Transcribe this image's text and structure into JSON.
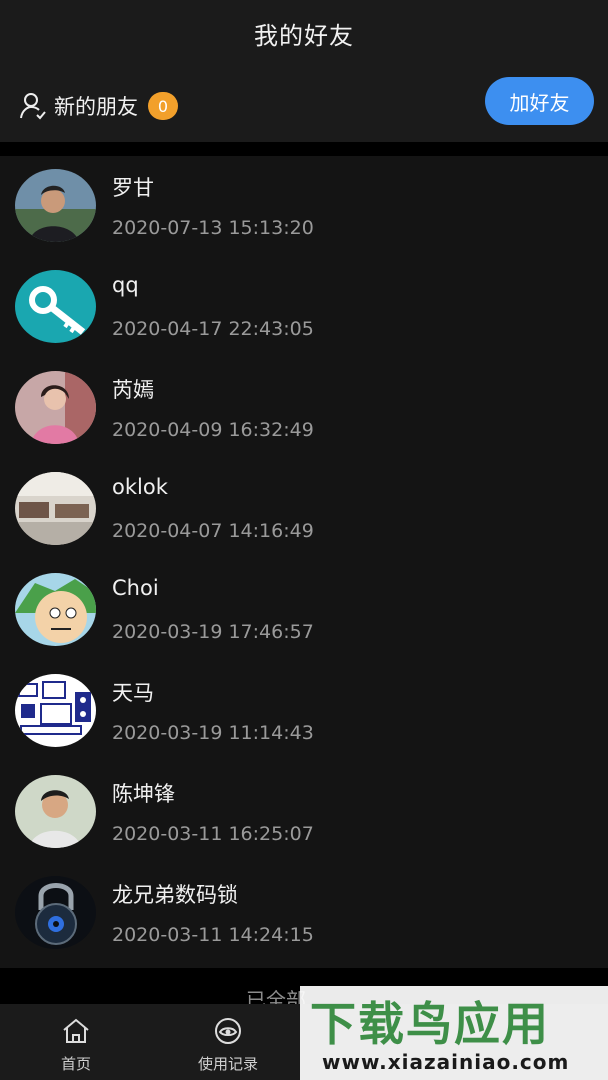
{
  "header": {
    "title": "我的好友",
    "new_friends_label": "新的朋友",
    "new_friends_count": "0",
    "add_friend_label": "加好友"
  },
  "friends": [
    {
      "name": "罗甘",
      "time": "2020-07-13 15:13:20",
      "avatar": "photo-person-icon"
    },
    {
      "name": "qq",
      "time": "2020-04-17 22:43:05",
      "avatar": "key-logo-icon"
    },
    {
      "name": "芮嫣",
      "time": "2020-04-09 16:32:49",
      "avatar": "photo-woman-icon"
    },
    {
      "name": "oklok",
      "time": "2020-04-07 14:16:49",
      "avatar": "photo-room-icon"
    },
    {
      "name": "Choi",
      "time": "2020-03-19 17:46:57",
      "avatar": "cartoon-face-icon"
    },
    {
      "name": "天马",
      "time": "2020-03-19 11:14:43",
      "avatar": "circuit-board-icon"
    },
    {
      "name": "陈坤锋",
      "time": "2020-03-11 16:25:07",
      "avatar": "photo-person-icon"
    },
    {
      "name": "龙兄弟数码锁",
      "time": "2020-03-11 14:24:15",
      "avatar": "padlock-icon"
    }
  ],
  "footer_text": "已全部",
  "tabs": [
    {
      "label": "首页",
      "icon": "home-icon"
    },
    {
      "label": "使用记录",
      "icon": "history-icon"
    }
  ],
  "watermark": {
    "logo": "下载鸟应用",
    "url": "www.xiazainiao.com"
  },
  "colors": {
    "accent": "#3d8ff0",
    "badge": "#f2a02b",
    "background": "#141414",
    "header": "#1b1b1b",
    "watermark_green": "#3e8f48"
  }
}
